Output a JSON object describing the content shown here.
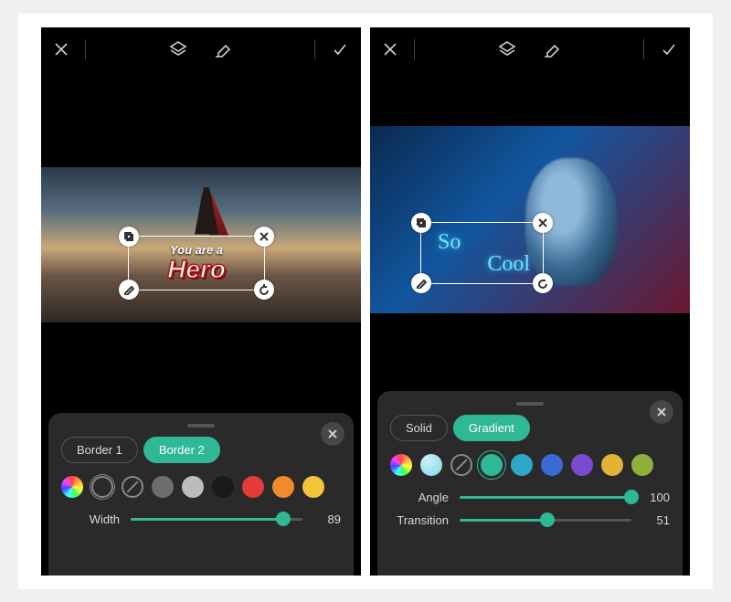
{
  "left": {
    "overlay": {
      "line1": "You are a",
      "line2": "Hero"
    },
    "panel": {
      "tabs": [
        {
          "label": "Border 1",
          "active": false
        },
        {
          "label": "Border 2",
          "active": true
        }
      ],
      "swatches": [
        {
          "kind": "rainbow"
        },
        {
          "kind": "outline",
          "selected": true
        },
        {
          "kind": "none"
        },
        {
          "color": "#6e6e6e"
        },
        {
          "color": "#bcbcbc"
        },
        {
          "color": "#1a1a1a"
        },
        {
          "color": "#e53a3a"
        },
        {
          "color": "#f08a2b"
        },
        {
          "color": "#f2c53a"
        }
      ],
      "sliders": [
        {
          "label": "Width",
          "value": 89,
          "max": 100
        }
      ]
    }
  },
  "right": {
    "overlay": {
      "line1": "So",
      "line2": "Cool"
    },
    "panel": {
      "tabs": [
        {
          "label": "Solid",
          "active": false
        },
        {
          "label": "Gradient",
          "active": true
        }
      ],
      "swatches": [
        {
          "kind": "rainbow"
        },
        {
          "color": "#7fd8e8",
          "glass": true
        },
        {
          "kind": "none"
        },
        {
          "color": "#2fb896",
          "selected": true
        },
        {
          "color": "#2fa8c8"
        },
        {
          "color": "#3a6ad6"
        },
        {
          "color": "#7a4ad0"
        },
        {
          "color": "#e0b238"
        },
        {
          "color": "#8fae3a"
        }
      ],
      "sliders": [
        {
          "label": "Angle",
          "value": 100,
          "max": 100
        },
        {
          "label": "Transition",
          "value": 51,
          "max": 100
        }
      ]
    }
  }
}
